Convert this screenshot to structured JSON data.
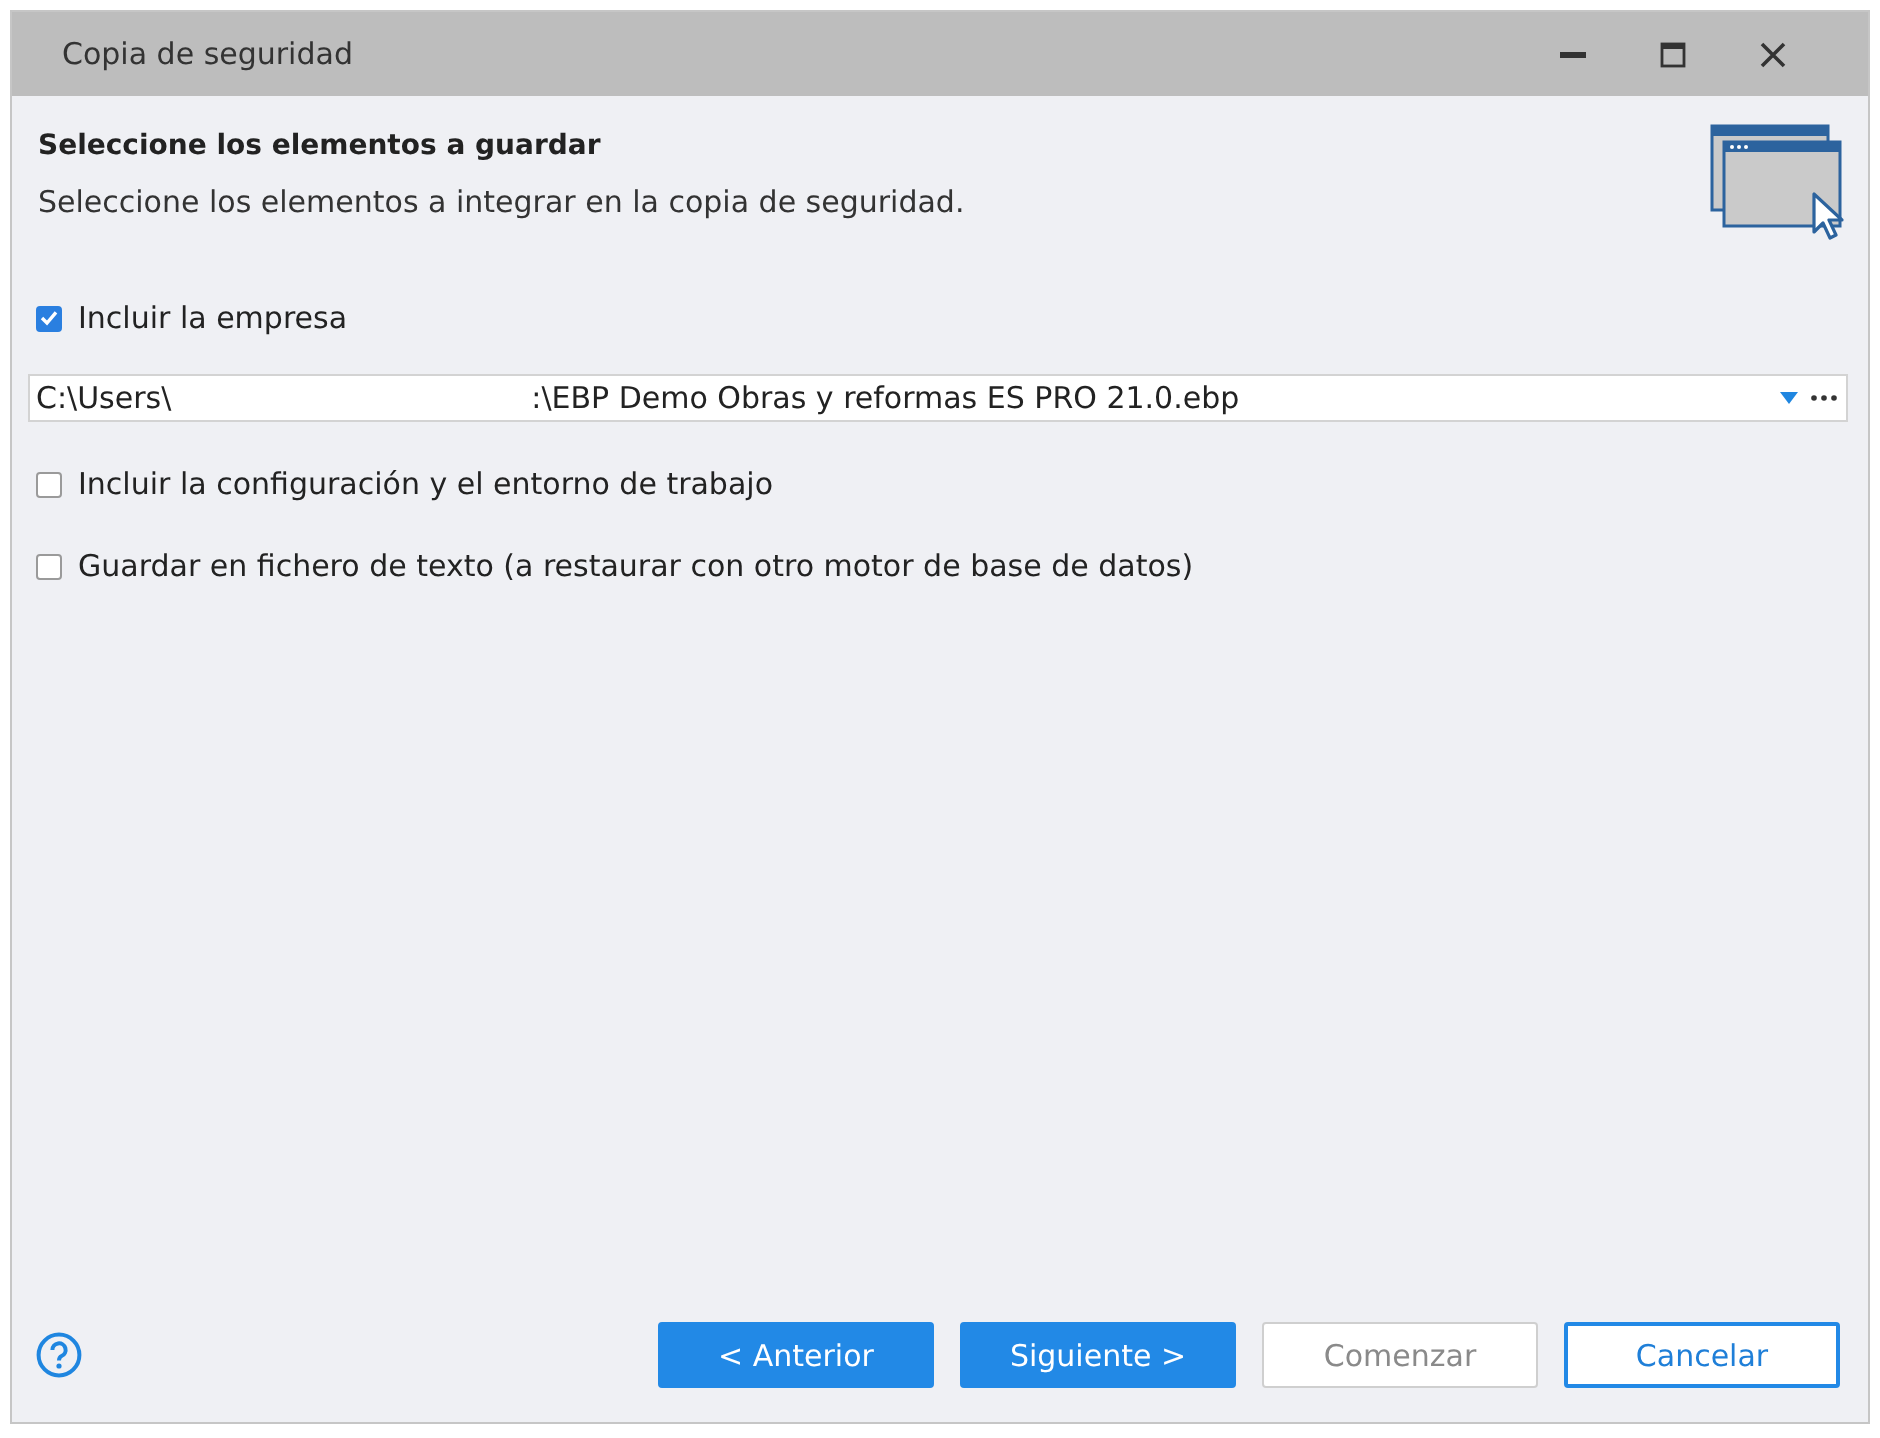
{
  "window": {
    "title": "Copia de seguridad"
  },
  "header": {
    "title": "Seleccione los elementos a guardar",
    "subtitle": "Seleccione los elementos a integrar en la copia de seguridad."
  },
  "options": [
    {
      "kind": "checkbox",
      "label": "Incluir la empresa",
      "checked": true
    },
    {
      "kind": "path",
      "value_start": "C:\\Users\\",
      "value_end": ":\\EBP Demo Obras y reformas ES PRO 21.0.ebp"
    },
    {
      "kind": "checkbox",
      "label": "Incluir la configuración y el entorno de trabajo",
      "checked": false
    },
    {
      "kind": "checkbox",
      "label": "Guardar en fichero de texto (a restaurar con otro motor de base de datos)",
      "checked": false
    }
  ],
  "buttons": [
    {
      "label": "< Anterior",
      "kind": "primary",
      "disabled": false,
      "focused": false
    },
    {
      "label": "Siguiente >",
      "kind": "primary",
      "disabled": false,
      "focused": false
    },
    {
      "label": "Comenzar",
      "kind": "secondary",
      "disabled": true,
      "focused": false
    },
    {
      "label": "Cancelar",
      "kind": "secondary",
      "disabled": false,
      "focused": true
    }
  ]
}
